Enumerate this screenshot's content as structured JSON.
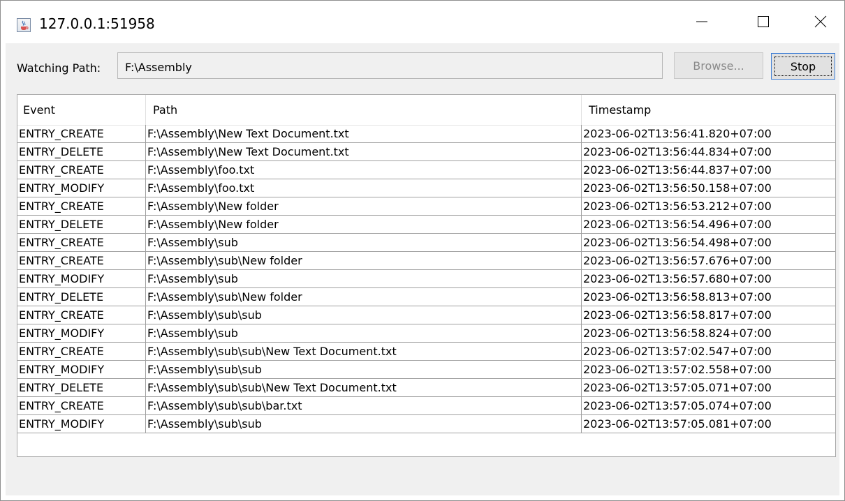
{
  "window": {
    "title": "127.0.0.1:51958",
    "icon": "java-cup-icon"
  },
  "watcher": {
    "label": "Watching Path:",
    "path": "F:\\Assembly",
    "browse_label": "Browse...",
    "stop_label": "Stop"
  },
  "table": {
    "columns": [
      "Event",
      "Path",
      "Timestamp"
    ],
    "rows": [
      [
        "ENTRY_CREATE",
        "F:\\Assembly\\New Text Document.txt",
        "2023-06-02T13:56:41.820+07:00"
      ],
      [
        "ENTRY_DELETE",
        "F:\\Assembly\\New Text Document.txt",
        "2023-06-02T13:56:44.834+07:00"
      ],
      [
        "ENTRY_CREATE",
        "F:\\Assembly\\foo.txt",
        "2023-06-02T13:56:44.837+07:00"
      ],
      [
        "ENTRY_MODIFY",
        "F:\\Assembly\\foo.txt",
        "2023-06-02T13:56:50.158+07:00"
      ],
      [
        "ENTRY_CREATE",
        "F:\\Assembly\\New folder",
        "2023-06-02T13:56:53.212+07:00"
      ],
      [
        "ENTRY_DELETE",
        "F:\\Assembly\\New folder",
        "2023-06-02T13:56:54.496+07:00"
      ],
      [
        "ENTRY_CREATE",
        "F:\\Assembly\\sub",
        "2023-06-02T13:56:54.498+07:00"
      ],
      [
        "ENTRY_CREATE",
        "F:\\Assembly\\sub\\New folder",
        "2023-06-02T13:56:57.676+07:00"
      ],
      [
        "ENTRY_MODIFY",
        "F:\\Assembly\\sub",
        "2023-06-02T13:56:57.680+07:00"
      ],
      [
        "ENTRY_DELETE",
        "F:\\Assembly\\sub\\New folder",
        "2023-06-02T13:56:58.813+07:00"
      ],
      [
        "ENTRY_CREATE",
        "F:\\Assembly\\sub\\sub",
        "2023-06-02T13:56:58.817+07:00"
      ],
      [
        "ENTRY_MODIFY",
        "F:\\Assembly\\sub",
        "2023-06-02T13:56:58.824+07:00"
      ],
      [
        "ENTRY_CREATE",
        "F:\\Assembly\\sub\\sub\\New Text Document.txt",
        "2023-06-02T13:57:02.547+07:00"
      ],
      [
        "ENTRY_MODIFY",
        "F:\\Assembly\\sub\\sub",
        "2023-06-02T13:57:02.558+07:00"
      ],
      [
        "ENTRY_DELETE",
        "F:\\Assembly\\sub\\sub\\New Text Document.txt",
        "2023-06-02T13:57:05.071+07:00"
      ],
      [
        "ENTRY_CREATE",
        "F:\\Assembly\\sub\\sub\\bar.txt",
        "2023-06-02T13:57:05.074+07:00"
      ],
      [
        "ENTRY_MODIFY",
        "F:\\Assembly\\sub\\sub",
        "2023-06-02T13:57:05.081+07:00"
      ]
    ]
  },
  "colors": {
    "client_bg": "#f0f0f0",
    "focus_border": "#3a7bd5",
    "disabled_text": "#8a8a8a"
  }
}
